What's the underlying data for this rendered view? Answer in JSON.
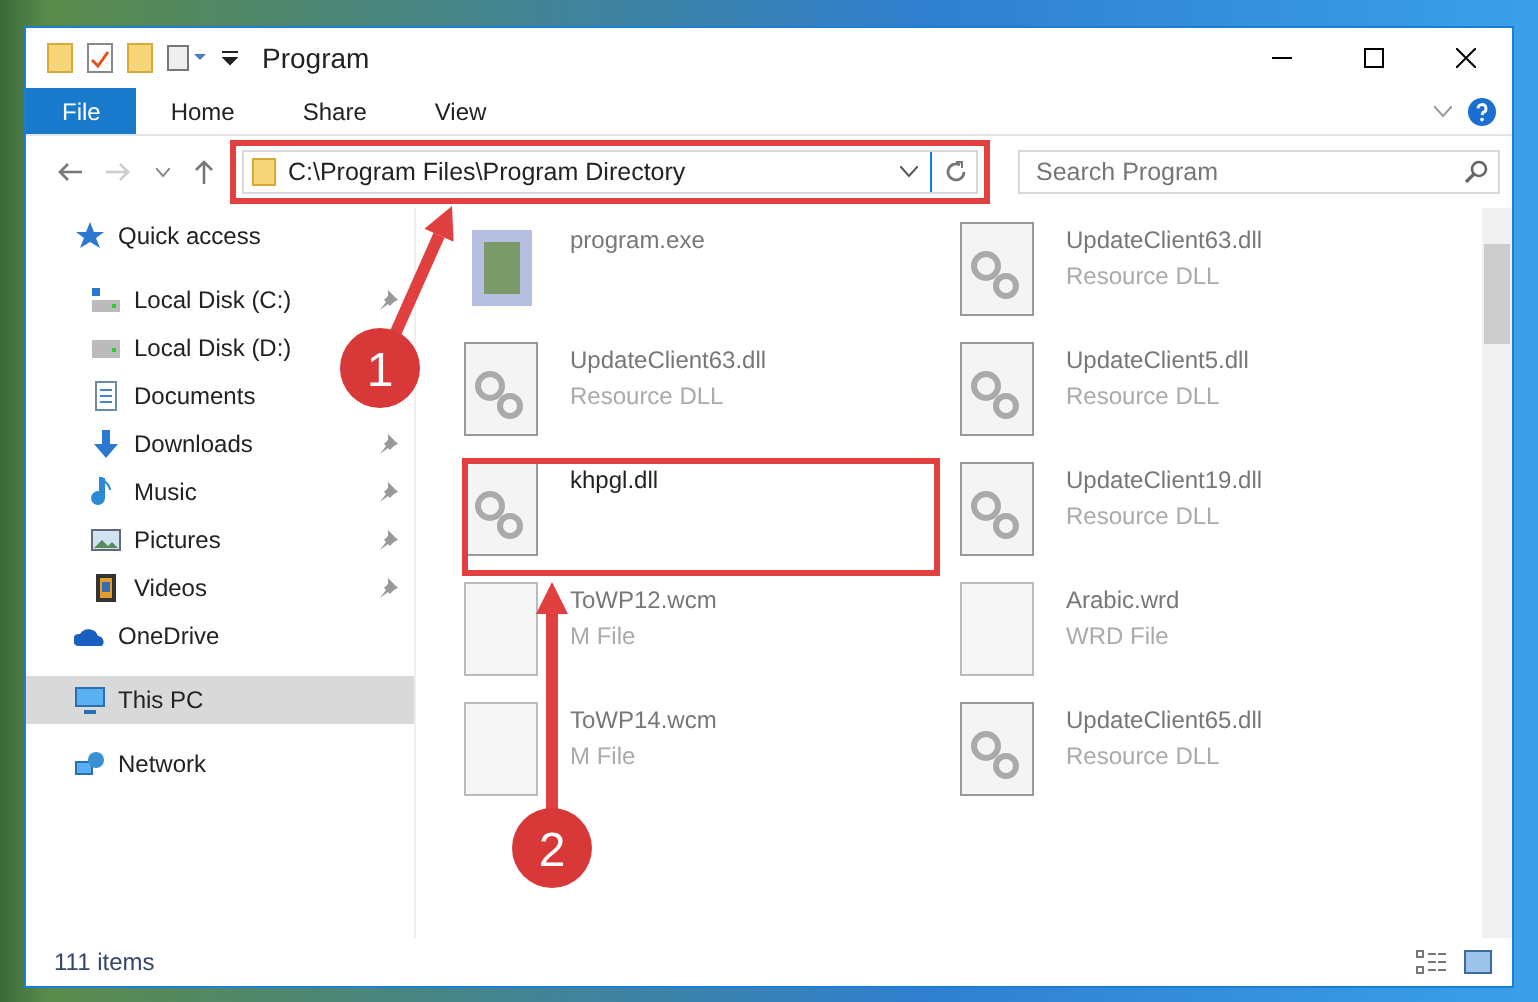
{
  "window": {
    "title": "Program"
  },
  "ribbon_tabs": [
    {
      "label": "File",
      "selected": true
    },
    {
      "label": "Home",
      "selected": false
    },
    {
      "label": "Share",
      "selected": false
    },
    {
      "label": "View",
      "selected": false
    }
  ],
  "address": {
    "path": "C:\\Program Files\\Program Directory"
  },
  "search": {
    "placeholder": "Search Program"
  },
  "sidebar": {
    "items": [
      {
        "label": "Quick access",
        "kind": "star",
        "selected": false,
        "children": [
          {
            "label": "Local Disk (C:)",
            "kind": "system-disk",
            "pinned": true
          },
          {
            "label": "Local Disk (D:)",
            "kind": "disk",
            "pinned": false
          },
          {
            "label": "Documents",
            "kind": "documents",
            "pinned": false
          },
          {
            "label": "Downloads",
            "kind": "downloads",
            "pinned": true
          },
          {
            "label": "Music",
            "kind": "music",
            "pinned": true
          },
          {
            "label": "Pictures",
            "kind": "pictures",
            "pinned": true
          },
          {
            "label": "Videos",
            "kind": "videos",
            "pinned": true
          }
        ]
      },
      {
        "label": "OneDrive",
        "kind": "cloud",
        "selected": false
      },
      {
        "label": "This PC",
        "kind": "pc",
        "selected": true
      },
      {
        "label": "Network",
        "kind": "network",
        "selected": false
      }
    ]
  },
  "files": [
    {
      "name": "program.exe",
      "kind": "exe",
      "highlighted": false
    },
    {
      "name": "UpdateClient63.dll",
      "type": "Resource DLL",
      "kind": "dll",
      "highlighted": false
    },
    {
      "name": "UpdateClient63.dll",
      "type": "Resource DLL",
      "kind": "dll",
      "highlighted": false
    },
    {
      "name": "UpdateClient5.dll",
      "type": "Resource DLL",
      "kind": "dll",
      "highlighted": false
    },
    {
      "name": "khpgl.dll",
      "kind": "dll",
      "highlighted": true
    },
    {
      "name": "UpdateClient19.dll",
      "type": "Resource DLL",
      "kind": "dll",
      "highlighted": false
    },
    {
      "name": "ToWP12.wcm",
      "type": "M File",
      "kind": "blank",
      "highlighted": false
    },
    {
      "name": "Arabic.wrd",
      "type": "WRD File",
      "kind": "blank",
      "highlighted": false
    },
    {
      "name": "ToWP14.wcm",
      "type": "M File",
      "kind": "blank",
      "highlighted": false
    },
    {
      "name": "UpdateClient65.dll",
      "type": "Resource DLL",
      "kind": "dll",
      "highlighted": false
    }
  ],
  "annotations": [
    {
      "number": "1"
    },
    {
      "number": "2"
    }
  ],
  "status_bar": {
    "count": "111 items"
  }
}
